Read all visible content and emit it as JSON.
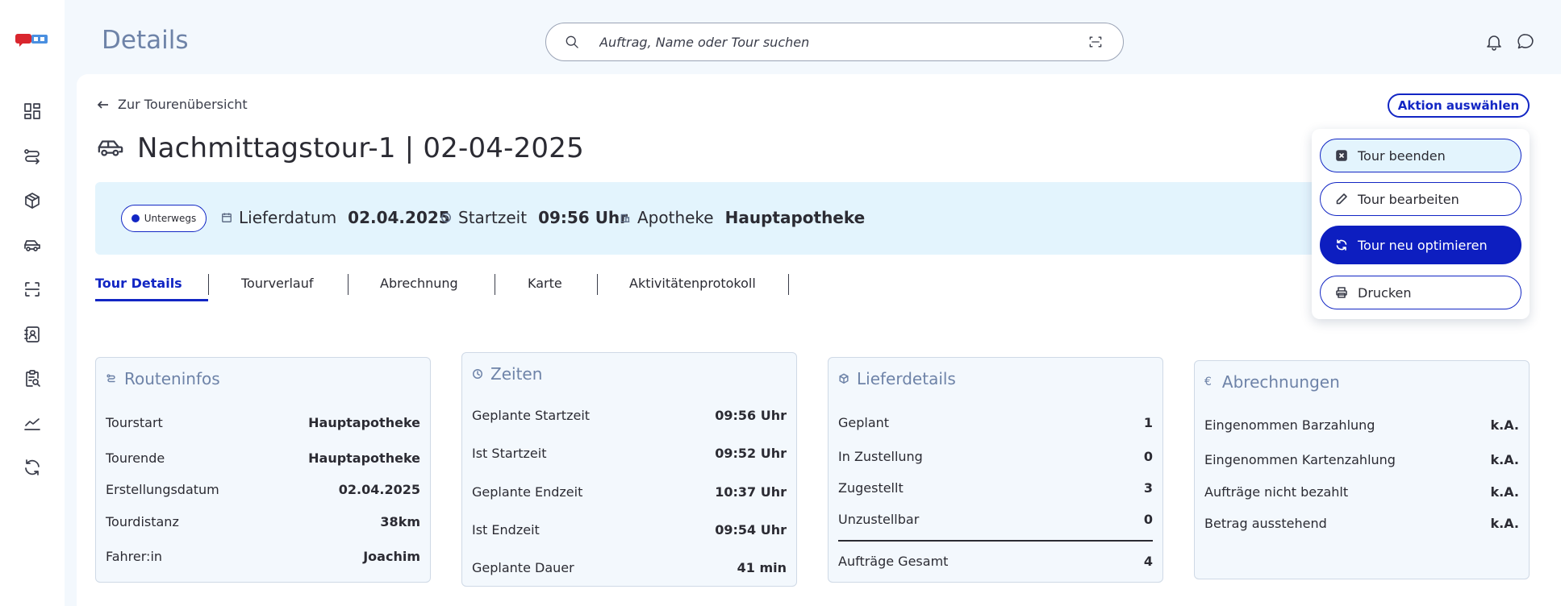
{
  "app": {
    "page_title": "Details"
  },
  "search": {
    "placeholder": "Auftrag, Name oder Tour suchen"
  },
  "sidebar": {
    "items": [
      {
        "icon": "dashboard-icon"
      },
      {
        "icon": "routes-icon"
      },
      {
        "icon": "package-icon"
      },
      {
        "icon": "car-icon"
      },
      {
        "icon": "scan-icon"
      },
      {
        "icon": "contacts-icon"
      },
      {
        "icon": "clipboard-search-icon"
      },
      {
        "icon": "analytics-icon"
      },
      {
        "icon": "sync-icon"
      }
    ]
  },
  "nav": {
    "back_label": "Zur Tourenübersicht"
  },
  "actions": {
    "button_label": "Aktion auswählen",
    "menu": [
      {
        "label": "Tour beenden",
        "icon": "stop-icon"
      },
      {
        "label": "Tour bearbeiten",
        "icon": "pencil-icon"
      },
      {
        "label": "Tour neu optimieren",
        "icon": "refresh-icon"
      },
      {
        "label": "Drucken",
        "icon": "printer-icon"
      }
    ]
  },
  "tour": {
    "title": "Nachmittagstour-1 | 02-04-2025",
    "status": "Unterwegs",
    "delivery_date_label": "Lieferdatum",
    "delivery_date": "02.04.2025",
    "start_time_label": "Startzeit",
    "start_time": "09:56 Uhr",
    "pharmacy_label": "Apotheke",
    "pharmacy": "Hauptapotheke"
  },
  "tabs": [
    {
      "label": "Tour Details",
      "active": true
    },
    {
      "label": "Tourverlauf",
      "active": false
    },
    {
      "label": "Abrechnung",
      "active": false
    },
    {
      "label": "Karte",
      "active": false
    },
    {
      "label": "Aktivitätenprotokoll",
      "active": false
    }
  ],
  "cards": {
    "route": {
      "title": "Routeninfos",
      "rows": [
        {
          "label": "Tourstart",
          "value": "Hauptapotheke"
        },
        {
          "label": "Tourende",
          "value": "Hauptapotheke"
        },
        {
          "label": "Erstellungsdatum",
          "value": "02.04.2025"
        },
        {
          "label": "Tourdistanz",
          "value": "38km"
        },
        {
          "label": "Fahrer:in",
          "value": "Joachim"
        }
      ]
    },
    "times": {
      "title": "Zeiten",
      "rows": [
        {
          "label": "Geplante Startzeit",
          "value": "09:56 Uhr"
        },
        {
          "label": "Ist Startzeit",
          "value": "09:52 Uhr"
        },
        {
          "label": "Geplante Endzeit",
          "value": "10:37 Uhr"
        },
        {
          "label": "Ist Endzeit",
          "value": "09:54 Uhr"
        },
        {
          "label": "Geplante Dauer",
          "value": "41 min"
        }
      ]
    },
    "delivery": {
      "title": "Lieferdetails",
      "rows": [
        {
          "label": "Geplant",
          "value": "1"
        },
        {
          "label": "In Zustellung",
          "value": "0"
        },
        {
          "label": "Zugestellt",
          "value": "3"
        },
        {
          "label": "Unzustellbar",
          "value": "0"
        }
      ],
      "total": {
        "label": "Aufträge Gesamt",
        "value": "4"
      }
    },
    "billing": {
      "title": "Abrechnungen",
      "currency_symbol": "€",
      "rows": [
        {
          "label": "Eingenommen Barzahlung",
          "value": "k.A."
        },
        {
          "label": "Eingenommen Kartenzahlung",
          "value": "k.A."
        },
        {
          "label": "Aufträge nicht bezahlt",
          "value": "k.A."
        },
        {
          "label": "Betrag ausstehend",
          "value": "k.A."
        }
      ]
    }
  },
  "colors": {
    "primary": "#1226c4",
    "title_muted": "#6e83a8",
    "info_bar_bg": "#e3f4fd",
    "page_bg": "#f3f8fd"
  }
}
